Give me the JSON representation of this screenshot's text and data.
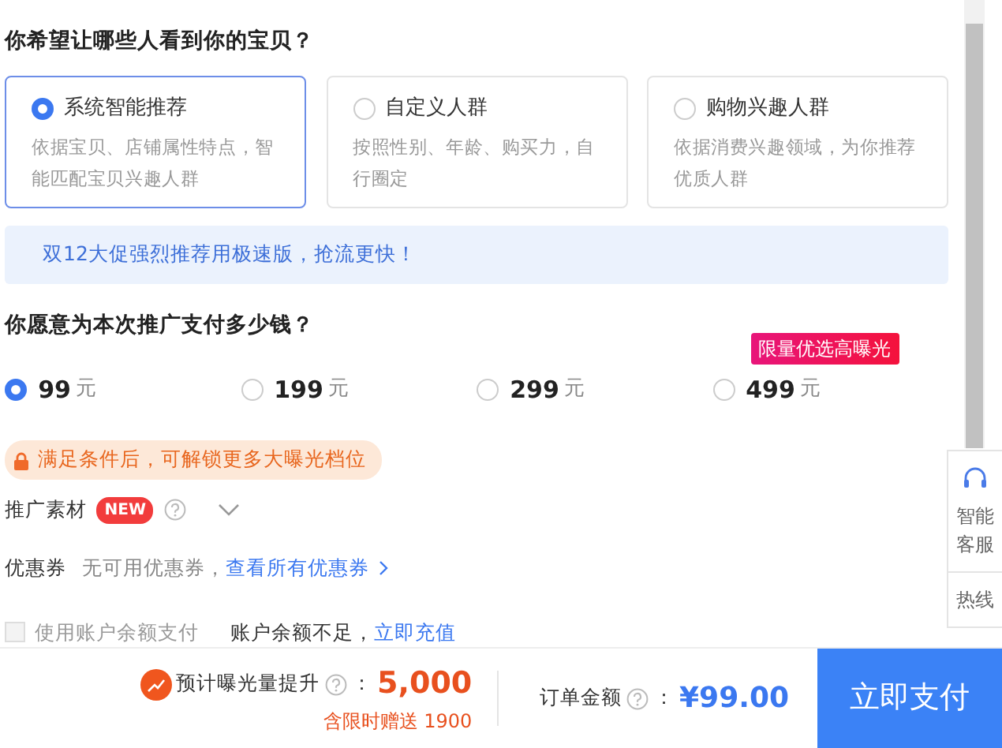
{
  "audience": {
    "title": "你希望让哪些人看到你的宝贝？",
    "options": [
      {
        "label": "系统智能推荐",
        "description": "依据宝贝、店铺属性特点，智能匹配宝贝兴趣人群",
        "selected": true
      },
      {
        "label": "自定义人群",
        "description": "按照性别、年龄、购买力，自行圈定",
        "selected": false
      },
      {
        "label": "购物兴趣人群",
        "description": "依据消费兴趣领域，为你推荐优质人群",
        "selected": false
      }
    ]
  },
  "banner": "双12大促强烈推荐用极速版，抢流更快！",
  "budget": {
    "title": "你愿意为本次推广支付多少钱？",
    "options": [
      {
        "amount": "99",
        "unit": "元",
        "selected": true
      },
      {
        "amount": "199",
        "unit": "元",
        "selected": false
      },
      {
        "amount": "299",
        "unit": "元",
        "selected": false
      },
      {
        "amount": "499",
        "unit": "元",
        "selected": false,
        "tag": "限量优选高曝光"
      }
    ]
  },
  "unlock_notice": "满足条件后，可解锁更多大曝光档位",
  "material": {
    "label": "推广素材",
    "badge": "NEW",
    "expanded": false
  },
  "coupon": {
    "label": "优惠券",
    "status": "无可用优惠券，",
    "link": "查看所有优惠券"
  },
  "balance": {
    "label": "使用账户余额支付",
    "checked": false,
    "disabled": true,
    "notice": "账户余额不足，",
    "link": "立即充值"
  },
  "footer": {
    "exposure_label": "预计曝光量提升",
    "exposure_colon": "：",
    "exposure_value": "5,000",
    "bonus": "含限时赠送 1900",
    "order_label": "订单金额",
    "order_colon": "：",
    "order_value": "¥99.00",
    "pay_button": "立即支付"
  },
  "side_panel": {
    "items": [
      {
        "kind": "service",
        "label": "智能客服"
      },
      {
        "kind": "text",
        "label": "热线"
      }
    ]
  }
}
